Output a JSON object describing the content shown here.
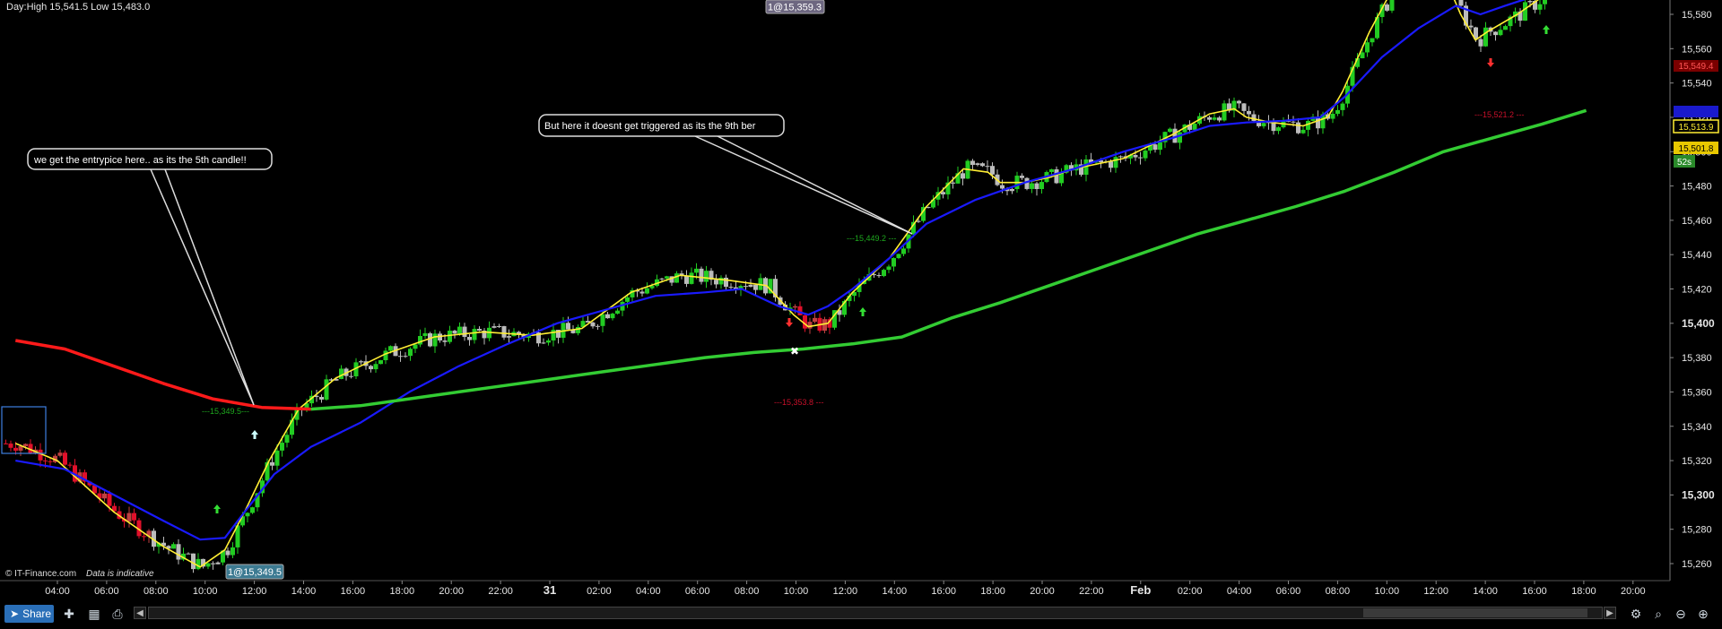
{
  "header": {
    "day_range": "Day:High 15,541.5 Low 15,483.0",
    "top_order_tag": "1@15,359.3",
    "bottom_order_tag": "1@15,349.5",
    "copyright": "© IT-Finance.com",
    "disclaimer": "Data is indicative"
  },
  "annotations": {
    "left_callout": "we get the entrypice here.. as its the 5th candle!!",
    "right_callout": "But here it doesnt get triggered as its the 9th ber"
  },
  "price_marks": {
    "entry_left": "---15,349.5---",
    "trigger_level": "---15,449.2 ---",
    "low_mark": "---15,353.8 ---",
    "right_low_mark": "---15,521.2 ---"
  },
  "price_tags": {
    "tag_red": "15,549.4",
    "tag_blue": "15,523.2",
    "tag_yellow": "15,513.9",
    "tag_orange": "15,501.8",
    "timer": "52s"
  },
  "colors": {
    "background": "#000000",
    "bull": "#22cc22",
    "bear": "#e0102a",
    "neutral": "#bbbbbb",
    "ema_fast": "#ffee33",
    "ema_mid": "#1a1aff",
    "ema_slow_red": "#ff1a1a",
    "ema_slow_green": "#33cc33"
  },
  "chart_data": {
    "type": "candlestick",
    "ylim": [
      15252,
      15600
    ],
    "y_ticks": [
      15260,
      15280,
      15300,
      15320,
      15340,
      15360,
      15380,
      15400,
      15420,
      15440,
      15460,
      15480,
      15500,
      15520,
      15540,
      15560,
      15580
    ],
    "y_tick_labels": [
      "15,260",
      "15,280",
      "15,300",
      "15,320",
      "15,340",
      "15,360",
      "15,380",
      "15,400",
      "15,420",
      "15,440",
      "15,460",
      "15,480",
      "15,500",
      "15,520",
      "15,540",
      "15,560",
      "15,580"
    ],
    "bold_y_ticks": [
      15300,
      15400
    ],
    "x_tick_labels": [
      "04:00",
      "06:00",
      "08:00",
      "10:00",
      "12:00",
      "14:00",
      "16:00",
      "18:00",
      "20:00",
      "22:00",
      "31",
      "02:00",
      "04:00",
      "06:00",
      "08:00",
      "10:00",
      "12:00",
      "14:00",
      "16:00",
      "18:00",
      "20:00",
      "22:00",
      "Feb",
      "02:00",
      "04:00",
      "06:00",
      "08:00",
      "10:00",
      "12:00",
      "14:00",
      "16:00",
      "18:00",
      "20:00"
    ],
    "bold_x_ticks": [
      "31",
      "Feb"
    ],
    "series": [
      {
        "name": "ema_fast",
        "color": "#ffee33",
        "width": 1.6,
        "x": [
          0,
          1.7,
          4,
          6,
          7.5,
          8.5,
          9.3,
          10.3,
          11.5,
          13,
          15,
          17,
          19,
          21,
          23,
          25,
          27,
          29,
          30.5,
          31.6,
          32.2,
          33,
          34,
          35.5,
          37,
          38.5,
          39.5,
          40,
          41,
          42,
          43,
          45,
          47,
          48.5,
          49.5,
          50,
          51,
          52.3,
          53.3,
          53.9,
          55,
          56.5,
          57.5,
          58.7,
          59.3,
          59.8,
          61,
          62,
          63,
          63.8
        ],
        "y": [
          15330,
          15320,
          15290,
          15270,
          15258,
          15268,
          15290,
          15320,
          15350,
          15368,
          15382,
          15392,
          15395,
          15393,
          15397,
          15418,
          15428,
          15425,
          15422,
          15405,
          15398,
          15400,
          15418,
          15438,
          15468,
          15490,
          15488,
          15482,
          15482,
          15485,
          15490,
          15496,
          15510,
          15522,
          15525,
          15520,
          15517,
          15515,
          15520,
          15535,
          15570,
          15610,
          15620,
          15580,
          15565,
          15570,
          15580,
          15590,
          15600,
          15605
        ]
      },
      {
        "name": "ema_mid",
        "color": "#1a1aff",
        "width": 2.2,
        "x": [
          0,
          2,
          4,
          6,
          7.5,
          8.5,
          9.3,
          10.5,
          12,
          14,
          16,
          18,
          20,
          22,
          24,
          26,
          28,
          29.5,
          31,
          32.2,
          33,
          34,
          35.5,
          37,
          39,
          41,
          43,
          45,
          47,
          48.5,
          50,
          51.5,
          53,
          54,
          55.5,
          57,
          58.5,
          59.5,
          60.5,
          62,
          63.8
        ],
        "y": [
          15320,
          15315,
          15300,
          15285,
          15274,
          15275,
          15290,
          15312,
          15328,
          15342,
          15360,
          15375,
          15388,
          15400,
          15408,
          15416,
          15418,
          15420,
          15410,
          15405,
          15410,
          15420,
          15438,
          15458,
          15472,
          15482,
          15490,
          15500,
          15508,
          15515,
          15517,
          15518,
          15520,
          15532,
          15555,
          15572,
          15585,
          15580,
          15585,
          15592,
          15600
        ]
      },
      {
        "name": "ema_slow_red",
        "color": "#ff1a1a",
        "width": 3.5,
        "x": [
          0,
          2,
          4,
          6,
          8,
          10,
          12
        ],
        "y": [
          15390,
          15385,
          15375,
          15365,
          15356,
          15351,
          15350
        ]
      },
      {
        "name": "ema_slow_green",
        "color": "#33cc33",
        "width": 3.5,
        "x": [
          12,
          14,
          16,
          18,
          20,
          22,
          24,
          26,
          28,
          30,
          32,
          34,
          36,
          38,
          40,
          42,
          44,
          46,
          48,
          50,
          52,
          54,
          56,
          58,
          60,
          62,
          63.8
        ],
        "y": [
          15350,
          15352,
          15356,
          15360,
          15364,
          15368,
          15372,
          15376,
          15380,
          15383,
          15385,
          15388,
          15392,
          15403,
          15412,
          15422,
          15432,
          15442,
          15452,
          15460,
          15468,
          15477,
          15488,
          15500,
          15508,
          15516,
          15524
        ]
      }
    ]
  }
}
